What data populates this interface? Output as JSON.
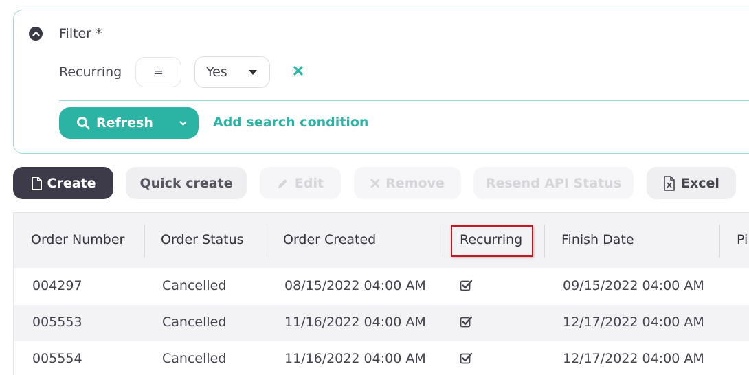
{
  "filter": {
    "title": "Filter *",
    "condition": {
      "field": "Recurring",
      "operator": "=",
      "value": "Yes"
    },
    "refresh_label": "Refresh",
    "add_condition_label": "Add search condition",
    "accent": "#2bb3a4"
  },
  "toolbar": {
    "create": "Create",
    "quick_create": "Quick create",
    "edit": "Edit",
    "remove": "Remove",
    "resend": "Resend API Status",
    "excel": "Excel"
  },
  "table": {
    "headers": [
      "Order Number",
      "Order Status",
      "Order Created",
      "Recurring",
      "Finish Date",
      "Pi"
    ],
    "rows": [
      {
        "order_number": "004297",
        "status": "Cancelled",
        "created": "08/15/2022 04:00 AM",
        "recurring": true,
        "finish": "09/15/2022 04:00 AM"
      },
      {
        "order_number": "005553",
        "status": "Cancelled",
        "created": "11/16/2022 04:00 AM",
        "recurring": true,
        "finish": "12/17/2022 04:00 AM"
      },
      {
        "order_number": "005554",
        "status": "Cancelled",
        "created": "11/16/2022 04:00 AM",
        "recurring": true,
        "finish": "12/17/2022 04:00 AM"
      }
    ],
    "highlight_color": "#c8161d"
  }
}
